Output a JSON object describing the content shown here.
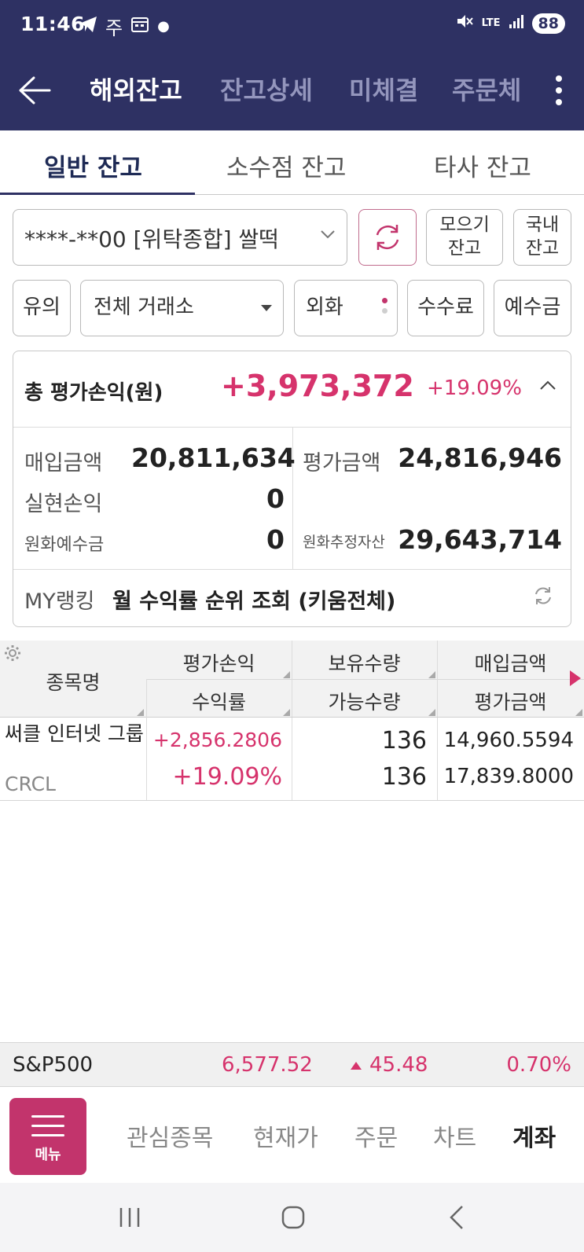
{
  "status_bar": {
    "time": "11:46",
    "notif_text": "주",
    "network": "LTE",
    "battery": "88"
  },
  "header": {
    "tabs": [
      "해외잔고",
      "잔고상세",
      "미체결",
      "주문체"
    ],
    "active_tab": 0
  },
  "sub_tabs": {
    "items": [
      "일반 잔고",
      "소수점 잔고",
      "타사 잔고"
    ],
    "active": 0
  },
  "account": {
    "label": "****-**00 [위탁종합] 쌀떡"
  },
  "buttons": {
    "collect_balance_line1": "모으기",
    "collect_balance_line2": "잔고",
    "domestic_balance_line1": "국내",
    "domestic_balance_line2": "잔고",
    "notice": "유의",
    "exchange": "전체 거래소",
    "currency": "외화",
    "fee": "수수료",
    "deposit": "예수금"
  },
  "summary": {
    "title": "총 평가손익(원)",
    "total_pl": "+3,973,372",
    "total_rate": "+19.09%",
    "purchase_label": "매입금액",
    "purchase_value": "20,811,634",
    "eval_label": "평가금액",
    "eval_value": "24,816,946",
    "realized_label": "실현손익",
    "realized_value": "0",
    "krw_deposit_label": "원화예수금",
    "krw_deposit_value": "0",
    "krw_est_label": "원화추정자산",
    "krw_est_value": "29,643,714",
    "ranking_label": "MY랭킹",
    "ranking_text": "월 수익률 순위 조회 (키움전체)"
  },
  "table": {
    "headers": {
      "name": "종목명",
      "pl": "평가손익",
      "rate": "수익률",
      "qty": "보유수량",
      "avail": "가능수량",
      "purchase": "매입금액",
      "eval": "평가금액"
    },
    "rows": [
      {
        "name": "써클 인터넷 그룹",
        "code": "CRCL",
        "pl": "+2,856.2806",
        "rate": "+19.09%",
        "qty": "136",
        "avail": "136",
        "purchase": "14,960.5594",
        "eval": "17,839.8000"
      }
    ]
  },
  "ticker": {
    "name": "S&P500",
    "value": "6,577.52",
    "change": "45.48",
    "percent": "0.70%"
  },
  "bottom_nav": {
    "menu_label": "메뉴",
    "items": [
      "관심종목",
      "현재가",
      "주문",
      "차트",
      "계좌"
    ],
    "active": 4
  },
  "colors": {
    "header_bg": "#2e3163",
    "accent_red": "#d6336c",
    "menu_bg": "#c2346c"
  }
}
